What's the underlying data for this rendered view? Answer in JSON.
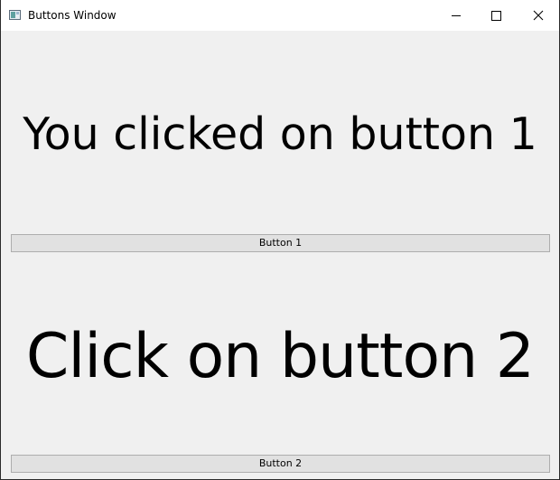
{
  "window": {
    "title": "Buttons Window",
    "controls": {
      "minimize": "minimize",
      "maximize": "maximize",
      "close": "close"
    }
  },
  "main": {
    "label_1": "You clicked on button 1",
    "button_1_label": "Button 1",
    "label_2": "Click on button 2",
    "button_2_label": "Button 2"
  },
  "colors": {
    "window_bg": "#f0f0f0",
    "titlebar_bg": "#ffffff",
    "button_bg": "#e1e1e1",
    "button_border": "#adadad",
    "text": "#000000"
  },
  "icons": [
    "app-window-icon",
    "minimize-icon",
    "maximize-icon",
    "close-icon"
  ]
}
